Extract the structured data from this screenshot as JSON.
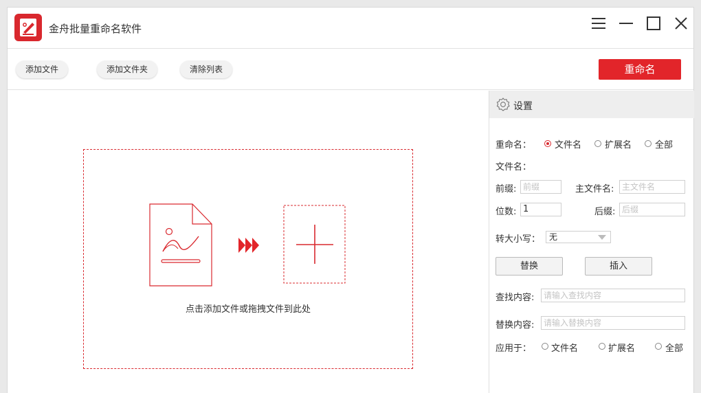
{
  "window": {
    "title": "金舟批量重命名软件"
  },
  "toolbar": {
    "add_file": "添加文件",
    "add_folder": "添加文件夹",
    "clear_list": "清除列表",
    "rename": "重命名"
  },
  "dropzone": {
    "hint": "点击添加文件或拖拽文件到此处"
  },
  "settings": {
    "title": "设置",
    "rename_label": "重命名：",
    "rename_options": [
      "文件名",
      "扩展名",
      "全部"
    ],
    "rename_selected": "文件名",
    "filename_label": "文件名：",
    "prefix_label": "前缀:",
    "prefix_placeholder": "前缀",
    "mainname_label": "主文件名:",
    "mainname_placeholder": "主文件名",
    "digits_label": "位数:",
    "digits_value": "1",
    "suffix_label": "后缀:",
    "suffix_placeholder": "后缀",
    "case_label": "转大小写：",
    "case_value": "无",
    "replace_button": "替换",
    "insert_button": "插入",
    "find_label": "查找内容:",
    "find_placeholder": "请输入查找内容",
    "replace_label": "替换内容:",
    "replace_placeholder": "请输入替换内容",
    "apply_label": "应用于：",
    "apply_options": [
      "文件名",
      "扩展名",
      "全部"
    ]
  },
  "colors": {
    "accent": "#e2252a",
    "logo": "#d9282e"
  },
  "icons": [
    "app-logo-icon",
    "menu-icon",
    "minimize-icon",
    "maximize-icon",
    "close-icon",
    "gear-icon",
    "document-icon",
    "arrow-forward-icon",
    "plus-icon"
  ]
}
